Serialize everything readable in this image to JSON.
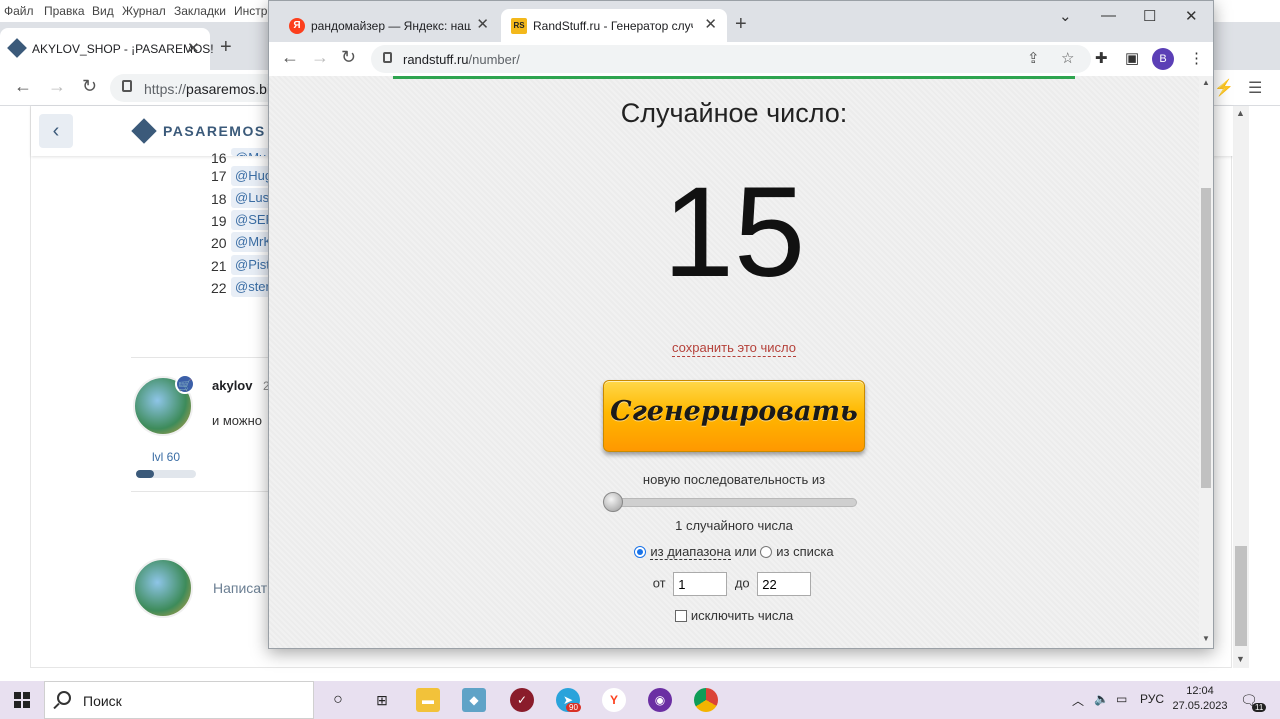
{
  "bg_window": {
    "menu": [
      "Файл",
      "Правка",
      "Вид",
      "Журнал",
      "Закладки",
      "Инстр"
    ],
    "tab_title": "AKYLOV_SHOP - ¡PASAREMOS!",
    "url_prefix": "https://",
    "url_host": "pasaremos.biz/",
    "site": {
      "back_label": "‹",
      "logo_text": "PASAREMOS",
      "rows": [
        {
          "num": "16",
          "mention": "@Mu"
        },
        {
          "num": "17",
          "mention": "@Hug"
        },
        {
          "num": "18",
          "mention": "@Lus"
        },
        {
          "num": "19",
          "mention": "@SER"
        },
        {
          "num": "20",
          "mention": "@MrK"
        },
        {
          "num": "21",
          "mention": "@Pist"
        },
        {
          "num": "22",
          "mention": "@ster"
        }
      ],
      "post": {
        "username": "akylov",
        "date_fragment": "2",
        "text": "и можно",
        "level_label": "lvl 60",
        "level_fraction": 0.3
      },
      "reply_placeholder": "Написат"
    }
  },
  "fg_window": {
    "tabs": [
      {
        "favicon": "Я",
        "title": "рандомайзер — Яндекс: нашло",
        "active": false
      },
      {
        "favicon": "RS",
        "title": "RandStuff.ru - Генератор случа",
        "active": true
      }
    ],
    "url_host": "randstuff.ru",
    "url_path": "/number/",
    "profile_letter": "B",
    "page": {
      "title": "Случайное число:",
      "number": "15",
      "save_link": "сохранить это число",
      "generate_label": "Сгенерировать",
      "sequence_label": "новую последовательность из",
      "count_label": "1 случайного числа",
      "mode_range": "из диапазона",
      "mode_or": "или",
      "mode_list": "из списка",
      "from_label": "от",
      "from_value": "1",
      "to_label": "до",
      "to_value": "22",
      "exclude_label": "исключить числа"
    }
  },
  "taskbar": {
    "search_placeholder": "Поиск",
    "telegram_badge": "90",
    "language": "РУС",
    "time": "12:04",
    "date": "27.05.2023",
    "notification_count": "11"
  },
  "colors": {
    "accent_green": "#2ea44f",
    "button_orange": "#ffb800",
    "link_red": "#b5413a",
    "brand_blue": "#3b5a7a"
  }
}
